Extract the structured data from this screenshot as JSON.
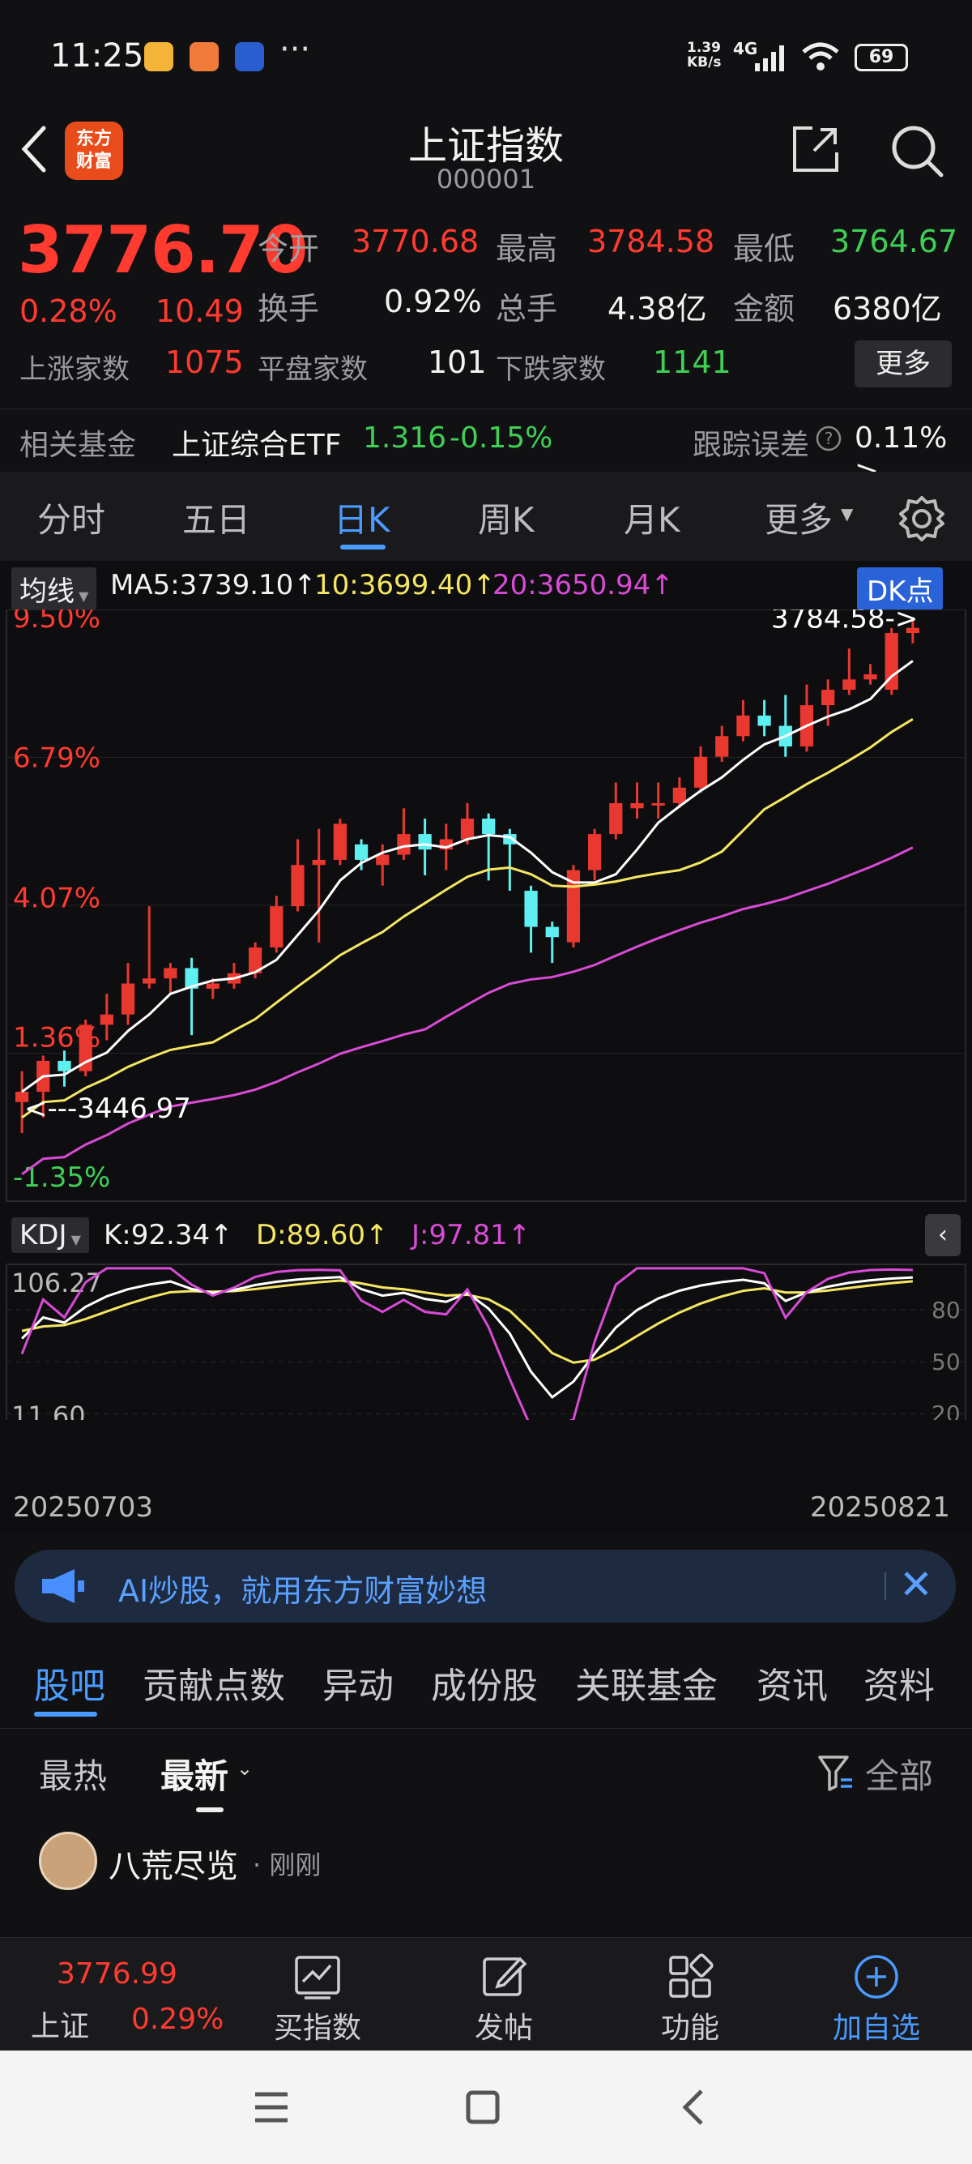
{
  "status": {
    "time": "11:25",
    "net_speed": "1.39\nKB/s",
    "net_type": "4G",
    "battery": "69"
  },
  "header": {
    "logo": "东方\n财富",
    "title": "上证指数",
    "code": "000001"
  },
  "quote": {
    "price": "3776.70",
    "change_pct": "0.28%",
    "change": "10.49",
    "open_label": "今开",
    "open": "3770.68",
    "high_label": "最高",
    "high": "3784.58",
    "low_label": "最低",
    "low": "3764.67",
    "turnover_label": "换手",
    "turnover": "0.92%",
    "volume_label": "总手",
    "volume": "4.38亿",
    "amount_label": "金额",
    "amount": "6380亿",
    "up_label": "上涨家数",
    "up": "1075",
    "flat_label": "平盘家数",
    "flat": "101",
    "down_label": "下跌家数",
    "down": "1141",
    "more": "更多"
  },
  "fund": {
    "label": "相关基金",
    "name": "上证综合ETF",
    "price": "1.316",
    "change": "-0.15%",
    "track_label": "跟踪误差",
    "track_value": "0.11% >"
  },
  "period_tabs": [
    "分时",
    "五日",
    "日K",
    "周K",
    "月K",
    "更多"
  ],
  "period_active": 2,
  "indicators": {
    "ma_selector": "均线",
    "ma5": "MA5:3739.10↑",
    "ma10": "10:3699.40↑",
    "ma20": "20:3650.94↑",
    "dk": "DK点",
    "kdj_selector": "KDJ",
    "k": "K:92.34↑",
    "d": "D:89.60↑",
    "j": "J:97.81↑"
  },
  "chart_data": {
    "type": "candlestick",
    "x_start": "20250703",
    "x_end": "20250821",
    "y_pct_labels": [
      "9.50%",
      "6.79%",
      "4.07%",
      "1.36%",
      "-1.35%"
    ],
    "high_marker": "3784.58->",
    "low_marker": "<---3446.97",
    "kdj_labels": [
      "106.27",
      "11.60"
    ],
    "kdj_ref": [
      "80",
      "50",
      "20"
    ],
    "candles_pct": [
      [
        0.1,
        0.3,
        -0.5,
        0.7
      ],
      [
        0.3,
        0.9,
        -0.2,
        1.0
      ],
      [
        0.9,
        0.7,
        0.4,
        1.1
      ],
      [
        0.7,
        1.6,
        0.6,
        1.7
      ],
      [
        1.6,
        1.8,
        1.3,
        2.2
      ],
      [
        1.8,
        2.4,
        1.6,
        2.8
      ],
      [
        2.4,
        2.5,
        2.3,
        3.9
      ],
      [
        2.5,
        2.7,
        2.2,
        2.8
      ],
      [
        2.7,
        2.3,
        1.4,
        2.9
      ],
      [
        2.3,
        2.4,
        2.1,
        2.5
      ],
      [
        2.4,
        2.6,
        2.3,
        2.8
      ],
      [
        2.6,
        3.1,
        2.5,
        3.2
      ],
      [
        3.1,
        3.9,
        3.0,
        4.1
      ],
      [
        3.9,
        4.7,
        3.8,
        5.2
      ],
      [
        4.7,
        4.8,
        3.2,
        5.4
      ],
      [
        4.8,
        5.5,
        4.7,
        5.6
      ],
      [
        5.1,
        4.8,
        4.6,
        5.2
      ],
      [
        4.7,
        4.9,
        4.3,
        5.1
      ],
      [
        4.9,
        5.3,
        4.8,
        5.8
      ],
      [
        5.3,
        5.0,
        4.5,
        5.6
      ],
      [
        5.0,
        5.2,
        4.6,
        5.5
      ],
      [
        5.2,
        5.6,
        5.1,
        5.9
      ],
      [
        5.6,
        5.3,
        4.4,
        5.7
      ],
      [
        5.3,
        5.1,
        4.2,
        5.4
      ],
      [
        4.2,
        3.5,
        3.0,
        4.3
      ],
      [
        3.5,
        3.3,
        2.8,
        3.6
      ],
      [
        3.2,
        4.6,
        3.1,
        4.7
      ],
      [
        4.6,
        5.3,
        4.4,
        5.4
      ],
      [
        5.3,
        5.9,
        5.2,
        6.3
      ],
      [
        5.8,
        5.9,
        5.6,
        6.3
      ],
      [
        5.9,
        5.9,
        5.6,
        6.3
      ],
      [
        5.9,
        6.2,
        5.8,
        6.4
      ],
      [
        6.2,
        6.8,
        6.1,
        7.0
      ],
      [
        6.8,
        7.2,
        6.7,
        7.4
      ],
      [
        7.2,
        7.6,
        7.1,
        7.9
      ],
      [
        7.6,
        7.4,
        7.2,
        7.9
      ],
      [
        7.4,
        7.0,
        6.8,
        8.0
      ],
      [
        7.0,
        7.8,
        6.9,
        8.2
      ],
      [
        7.8,
        8.1,
        7.4,
        8.3
      ],
      [
        8.1,
        8.3,
        8.0,
        8.9
      ],
      [
        8.3,
        8.4,
        8.2,
        8.6
      ],
      [
        8.1,
        9.2,
        8.0,
        9.3
      ],
      [
        9.2,
        9.3,
        9.0,
        9.5
      ]
    ]
  },
  "ad": {
    "text": "AI炒股，就用东方财富妙想"
  },
  "content_tabs": [
    "股吧",
    "贡献点数",
    "异动",
    "成份股",
    "关联基金",
    "资讯",
    "资料"
  ],
  "content_active": 0,
  "sort": {
    "hot": "最热",
    "new": "最新",
    "filter": "全部"
  },
  "post": {
    "user": "八荒尽览",
    "time": "· 刚刚"
  },
  "bottom": {
    "index_price": "3776.99",
    "index_name": "上证",
    "index_pct": "0.29%",
    "buy": "买指数",
    "post": "发帖",
    "func": "功能",
    "add": "加自选"
  }
}
